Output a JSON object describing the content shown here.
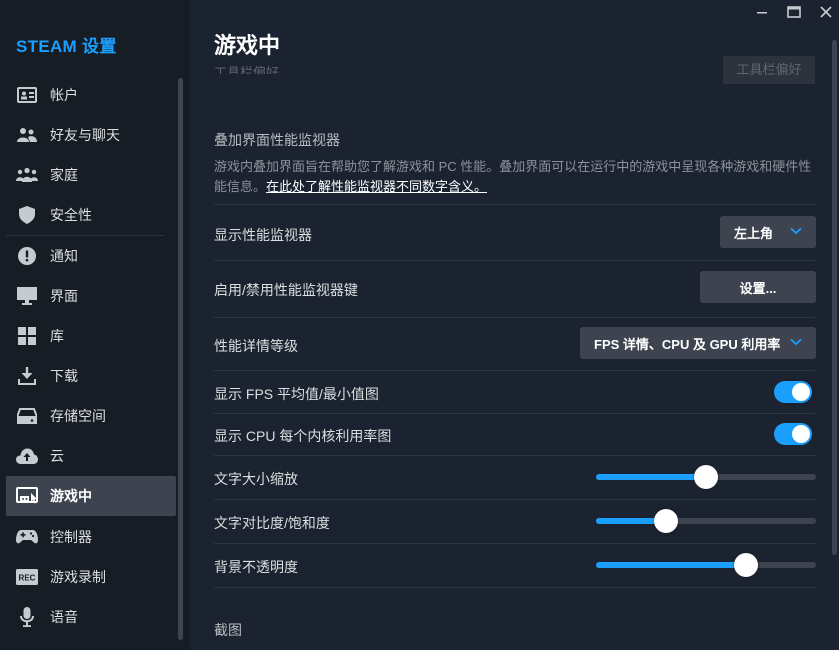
{
  "sidebar": {
    "title": "STEAM 设置",
    "items": [
      {
        "label": "帐户",
        "icon": "account-card-icon"
      },
      {
        "label": "好友与聊天",
        "icon": "friends-icon"
      },
      {
        "label": "家庭",
        "icon": "family-icon"
      },
      {
        "label": "安全性",
        "icon": "shield-icon"
      },
      {
        "label": "通知",
        "icon": "alert-icon"
      },
      {
        "label": "界面",
        "icon": "monitor-icon"
      },
      {
        "label": "库",
        "icon": "grid-icon"
      },
      {
        "label": "下载",
        "icon": "download-icon"
      },
      {
        "label": "存储空间",
        "icon": "storage-icon"
      },
      {
        "label": "云",
        "icon": "cloud-icon"
      },
      {
        "label": "游戏中",
        "icon": "in-game-icon",
        "active": true
      },
      {
        "label": "控制器",
        "icon": "controller-icon"
      },
      {
        "label": "游戏录制",
        "icon": "rec-icon"
      },
      {
        "label": "语音",
        "icon": "microphone-icon"
      }
    ]
  },
  "main": {
    "title": "游戏中",
    "cutoff_label": "工具栏偏好",
    "cutoff_button": "工具栏偏好",
    "overlay_section": {
      "title": "叠加界面性能监视器",
      "description": "游戏内叠加界面旨在帮助您了解游戏和 PC 性能。叠加界面可以在运行中的游戏中呈现各种游戏和硬件性能信息。",
      "link": "在此处了解性能监视器不同数字含义。"
    },
    "rows": {
      "show_monitor": {
        "label": "显示性能监视器",
        "value": "左上角"
      },
      "toggle_key": {
        "label": "启用/禁用性能监视器键",
        "button": "设置..."
      },
      "detail_level": {
        "label": "性能详情等级",
        "value": "FPS 详情、CPU 及 GPU 利用率"
      },
      "fps_avg": {
        "label": "显示 FPS 平均值/最小值图",
        "on": true
      },
      "cpu_core": {
        "label": "显示 CPU 每个内核利用率图",
        "on": true
      },
      "text_scale": {
        "label": "文字大小缩放",
        "level": 0.5
      },
      "text_contrast": {
        "label": "文字对比度/饱和度",
        "level": 0.32
      },
      "bg_opacity": {
        "label": "背景不透明度",
        "level": 0.68
      }
    },
    "screenshot_section": {
      "title": "截图"
    }
  },
  "colors": {
    "accent": "#1a9fff",
    "sidebar_bg": "#171d25",
    "main_bg": "#1b2331"
  }
}
